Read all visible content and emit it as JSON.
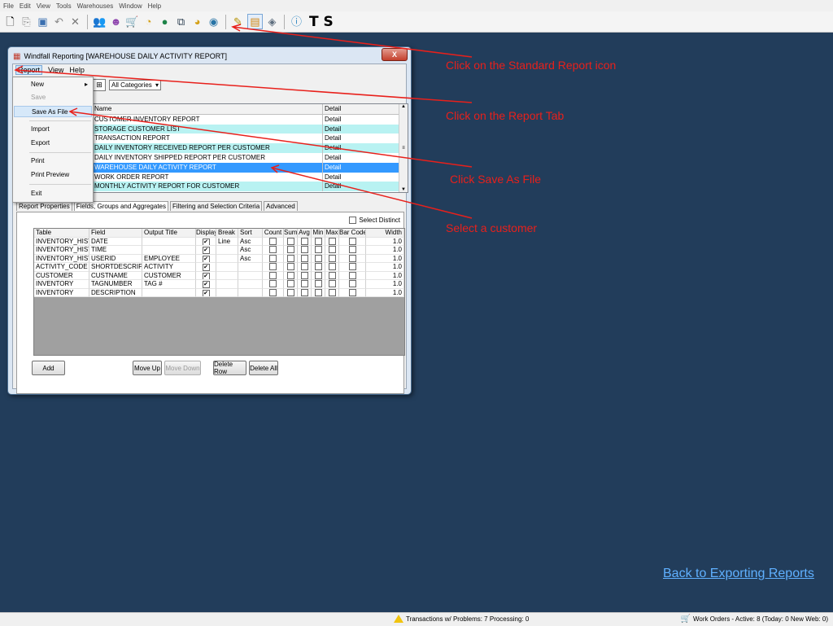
{
  "app": {
    "menu": [
      "File",
      "Edit",
      "View",
      "Tools",
      "Warehouses",
      "Window",
      "Help"
    ],
    "toolbar_text": "T S"
  },
  "window": {
    "title": "Windfall Reporting [WAREHOUSE DAILY ACTIVITY REPORT]",
    "close_label": "X",
    "menu": [
      "Report",
      "View",
      "Help"
    ],
    "category_select": "All Categories"
  },
  "report_list": {
    "col_name": "Name",
    "col_detail": "Detail",
    "rows": [
      {
        "name": "CUSTOMER INVENTORY REPORT",
        "detail": "Detail",
        "style": "plain"
      },
      {
        "name": "STORAGE CUSTOMER LIST",
        "detail": "Detail",
        "style": "alt"
      },
      {
        "name": "TRANSACTION REPORT",
        "detail": "Detail",
        "style": "plain"
      },
      {
        "name": "DAILY INVENTORY RECEIVED REPORT PER CUSTOMER",
        "detail": "Detail",
        "style": "alt"
      },
      {
        "name": "DAILY INVENTORY SHIPPED REPORT PER CUSTOMER",
        "detail": "Detail",
        "style": "plain"
      },
      {
        "name": "WAREHOUSE DAILY ACTIVITY REPORT",
        "detail": "Detail",
        "style": "sel"
      },
      {
        "name": "WORK ORDER REPORT",
        "detail": "Detail",
        "style": "plain"
      },
      {
        "name": "MONTHLY ACTIVITY REPORT FOR CUSTOMER",
        "detail": "Detail",
        "style": "alt"
      }
    ]
  },
  "context_menu": {
    "new": "New",
    "save": "Save",
    "save_as": "Save As File",
    "import": "Import",
    "export": "Export",
    "print": "Print",
    "print_preview": "Print Preview",
    "exit": "Exit",
    "submenu_arrow": "▸"
  },
  "tabs": [
    "Report Properties",
    "Fields, Groups and Aggregates",
    "Filtering and Selection Criteria",
    "Advanced"
  ],
  "select_distinct": "Select Distinct",
  "grid": {
    "headers": [
      "Table",
      "Field",
      "Output Title",
      "Display",
      "Break",
      "Sort",
      "Count",
      "Sum",
      "Avg",
      "Min",
      "Max",
      "Bar Code",
      "Width"
    ],
    "rows": [
      {
        "table": "INVENTORY_HISTO",
        "field": "DATE",
        "output": "",
        "display": true,
        "break": "Line",
        "sort": "Asc",
        "width": "1.0"
      },
      {
        "table": "INVENTORY_HISTO",
        "field": "TIME",
        "output": "",
        "display": true,
        "break": "",
        "sort": "Asc",
        "width": "1.0"
      },
      {
        "table": "INVENTORY_HISTO",
        "field": "USERID",
        "output": "EMPLOYEE",
        "display": true,
        "break": "",
        "sort": "Asc",
        "width": "1.0"
      },
      {
        "table": "ACTIVITY_CODE",
        "field": "SHORTDESCRIPTIC",
        "output": "ACTIVITY",
        "display": true,
        "break": "",
        "sort": "",
        "width": "1.0"
      },
      {
        "table": "CUSTOMER",
        "field": "CUSTNAME",
        "output": "CUSTOMER",
        "display": true,
        "break": "",
        "sort": "",
        "width": "1.0"
      },
      {
        "table": "INVENTORY",
        "field": "TAGNUMBER",
        "output": "TAG #",
        "display": true,
        "break": "",
        "sort": "",
        "width": "1.0"
      },
      {
        "table": "INVENTORY",
        "field": "DESCRIPTION",
        "output": "",
        "display": true,
        "break": "",
        "sort": "",
        "width": "1.0"
      }
    ]
  },
  "buttons": {
    "add": "Add",
    "move_up": "Move Up",
    "move_down": "Move Down",
    "delete_row": "Delete Row",
    "delete_all": "Delete All"
  },
  "annotations": {
    "a1": "Click on the Standard Report icon",
    "a2": "Click on the Report Tab",
    "a3": "Click Save As File",
    "a4": "Select a customer",
    "color": "#e8201b"
  },
  "back_link": "Back to Exporting Reports",
  "status": {
    "left": "Transactions w/ Problems: 7  Processing: 0",
    "right": "Work Orders - Active: 8  (Today: 0  New Web: 0)"
  }
}
